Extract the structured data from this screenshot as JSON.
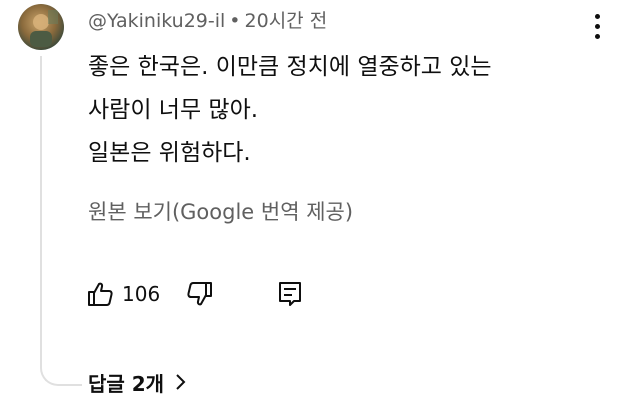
{
  "comment": {
    "author": "@Yakiniku29-il",
    "separator": "•",
    "timestamp": "20시간 전",
    "lines": [
      "좋은 한국은. 이만큼 정치에 열중하고 있는",
      "사람이 너무 많아.",
      "일본은 위험하다."
    ],
    "translation_link": "원본 보기(Google 번역 제공)",
    "like_count": "106",
    "replies_label": "답글 2개"
  },
  "icons": {
    "avatar": "avatar",
    "more": "more-vert-icon",
    "like": "thumb-up-icon",
    "dislike": "thumb-down-icon",
    "reply": "reply-icon",
    "chevron": "chevron-right-icon"
  }
}
